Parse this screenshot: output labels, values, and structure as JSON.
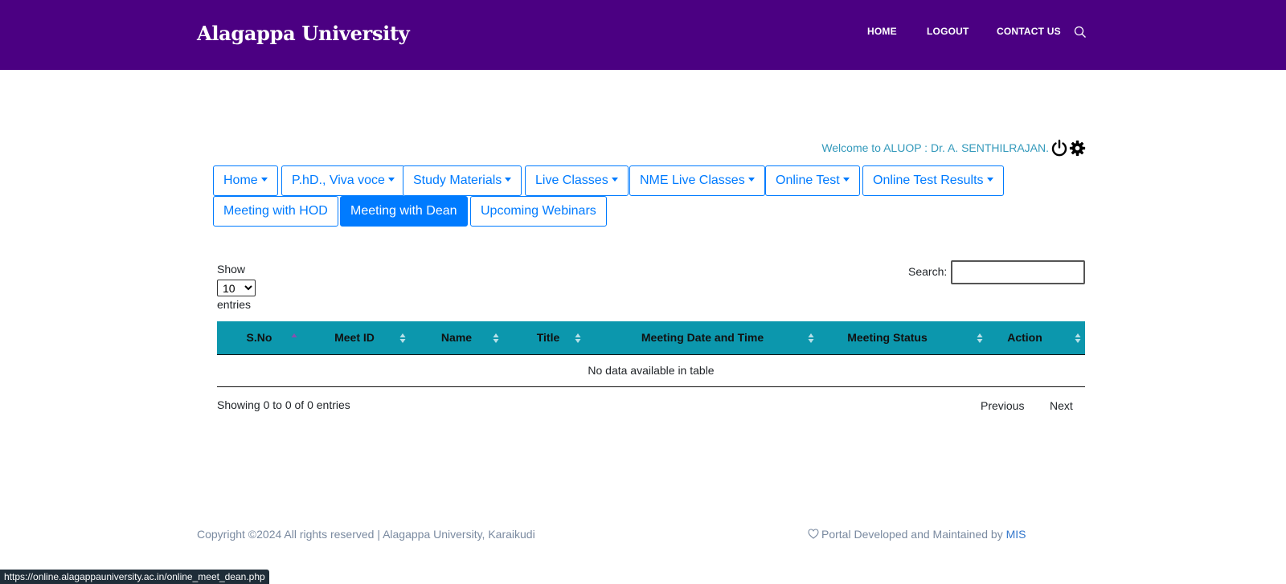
{
  "header": {
    "brand": "Alagappa University",
    "nav": [
      "HOME",
      "LOGOUT",
      "CONTACT US"
    ]
  },
  "welcome": "Welcome to ALUOP : Dr. A. SENTHILRAJAN.",
  "menu": {
    "row1": [
      {
        "label": "Home",
        "dropdown": true
      },
      {
        "label": "P.hD., Viva voce",
        "dropdown": true
      },
      {
        "label": "Study Materials",
        "dropdown": true
      },
      {
        "label": "Live Classes",
        "dropdown": true
      },
      {
        "label": "NME Live Classes",
        "dropdown": true
      },
      {
        "label": "Online Test",
        "dropdown": true
      },
      {
        "label": "Online Test Results",
        "dropdown": true
      }
    ],
    "row2": [
      {
        "label": "Meeting with HOD",
        "active": false
      },
      {
        "label": "Meeting with Dean",
        "active": true
      },
      {
        "label": "Upcoming Webinars",
        "active": false
      }
    ]
  },
  "datatable": {
    "show_label": "Show",
    "length_value": "10",
    "entries_label": "entries",
    "search_label": "Search:",
    "search_value": "",
    "columns": [
      "S.No",
      "Meet ID",
      "Name",
      "Title",
      "Meeting Date and Time",
      "Meeting Status",
      "Action"
    ],
    "empty_message": "No data available in table",
    "info": "Showing 0 to 0 of 0 entries",
    "previous": "Previous",
    "next": "Next"
  },
  "footer": {
    "copyright": "Copyright ©2024 All rights reserved | Alagappa University, Karaikudi",
    "maintained": "Portal Developed and Maintained by",
    "mis": "MIS"
  },
  "status_url": "https://online.alagappauniversity.ac.in/online_meet_dean.php",
  "colors": {
    "header_bg": "#4b0082",
    "primary": "#007bff",
    "table_head": "#0c97ad",
    "welcome": "#3399bb"
  }
}
